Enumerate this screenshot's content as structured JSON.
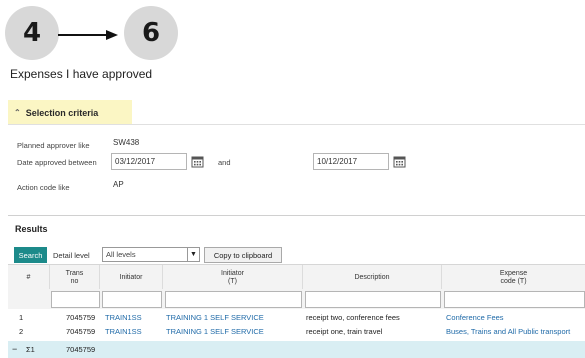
{
  "steps": {
    "from": "4",
    "to": "6"
  },
  "page": {
    "title": "Expenses I have approved"
  },
  "criteria": {
    "header": "Selection criteria",
    "approver_label": "Planned approver like",
    "approver_value": "SW438",
    "date_label": "Date approved between",
    "date_from": "03/12/2017",
    "and_label": "and",
    "date_to": "10/12/2017",
    "action_label": "Action code like",
    "action_value": "AP"
  },
  "results": {
    "title": "Results",
    "search_label": "Search",
    "detail_label": "Detail level",
    "detail_value": "All levels",
    "copy_label": "Copy to clipboard",
    "columns": [
      "#",
      "Trans\nno",
      "Initiator",
      "Initiator\n(T)",
      "Description",
      "Expense\ncode (T)"
    ],
    "rows": [
      {
        "num": "1",
        "trans": "7045759",
        "initiator": "TRAIN1SS",
        "initiator_t": "TRAINING 1 SELF SERVICE",
        "description": "receipt two, conference fees",
        "expense": "Conference Fees"
      },
      {
        "num": "2",
        "trans": "7045759",
        "initiator": "TRAIN1SS",
        "initiator_t": "TRAINING 1 SELF SERVICE",
        "description": "receipt one, train travel",
        "expense": "Buses, Trains and All Public transport"
      }
    ],
    "summary": {
      "collapse": "−",
      "sigma": "Σ1",
      "trans": "7045759"
    }
  },
  "colors": {
    "accent": "#1c8a8a",
    "link": "#1f6aa8",
    "highlight": "#fbf6c4",
    "summary_bg": "#d9eef3"
  }
}
